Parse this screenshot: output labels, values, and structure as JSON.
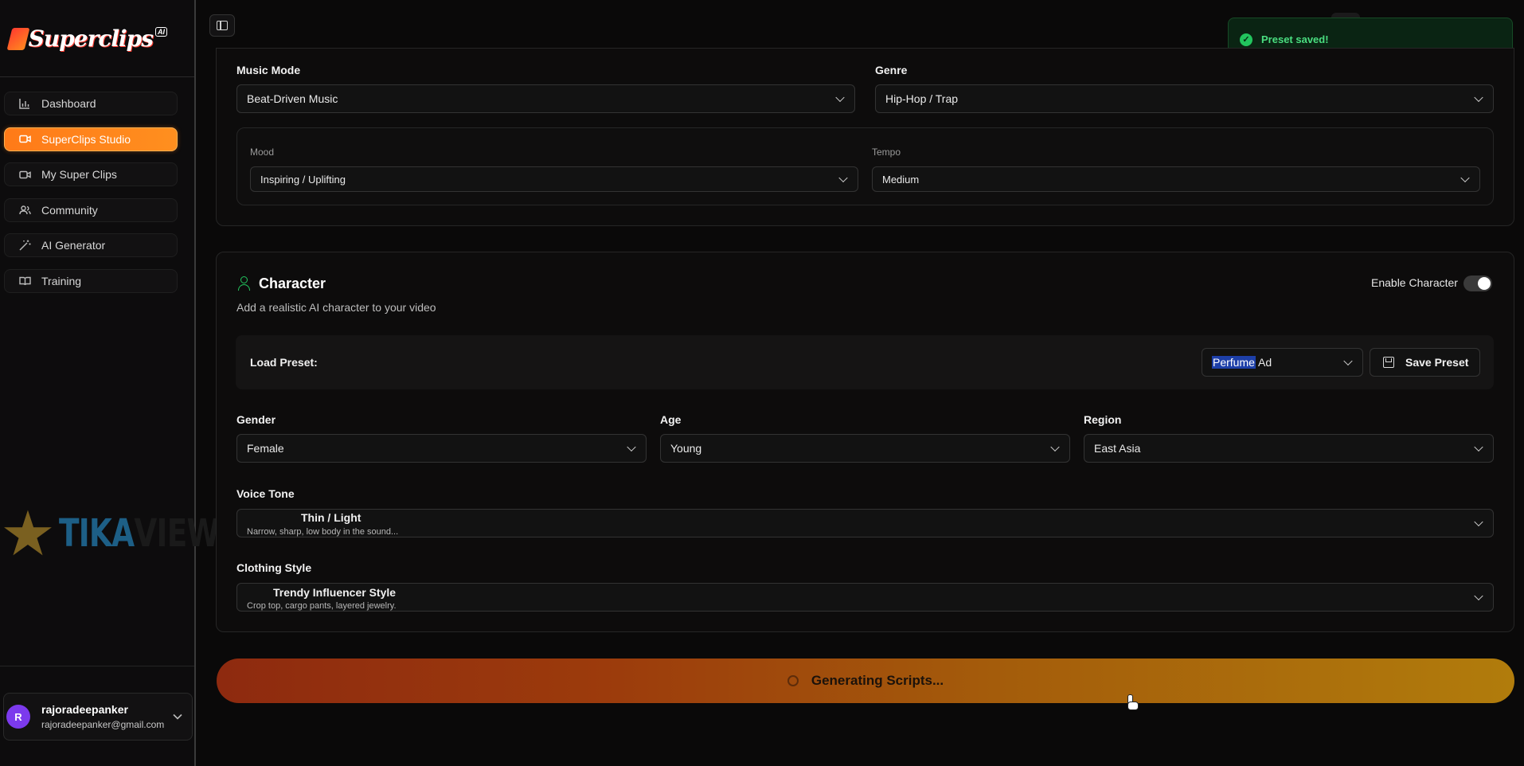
{
  "brand": {
    "name": "Superclips",
    "badge": "AI"
  },
  "watermark": {
    "text_main": "TIKA",
    "text_faded": "VIEW"
  },
  "sidebar": {
    "items": [
      {
        "label": "Dashboard",
        "icon": "bar-chart-icon",
        "active": false
      },
      {
        "label": "SuperClips Studio",
        "icon": "video-camera-icon",
        "active": true
      },
      {
        "label": "My Super Clips",
        "icon": "video-camera-icon",
        "active": false
      },
      {
        "label": "Community",
        "icon": "users-icon",
        "active": false
      },
      {
        "label": "AI Generator",
        "icon": "magic-wand-icon",
        "active": false
      },
      {
        "label": "Training",
        "icon": "book-open-icon",
        "active": false
      }
    ]
  },
  "user": {
    "initial": "R",
    "name": "rajoradeepanker",
    "email": "rajoradeepanker@gmail.com"
  },
  "toast": {
    "text": "Preset saved!",
    "color": "#22c55e"
  },
  "music": {
    "mode_label": "Music Mode",
    "mode_value": "Beat-Driven Music",
    "genre_label": "Genre",
    "genre_value": "Hip-Hop / Trap",
    "mood_label": "Mood",
    "mood_value": "Inspiring / Uplifting",
    "tempo_label": "Tempo",
    "tempo_value": "Medium"
  },
  "character": {
    "title": "Character",
    "description": "Add a realistic AI character to your video",
    "enable_label": "Enable Character",
    "enabled": true,
    "preset_label": "Load Preset:",
    "preset_value_highlight": "Perfume",
    "preset_value_rest": " Ad",
    "save_preset_label": "Save Preset",
    "gender_label": "Gender",
    "gender_value": "Female",
    "age_label": "Age",
    "age_value": "Young",
    "region_label": "Region",
    "region_value": "East Asia",
    "voice_label": "Voice Tone",
    "voice_value": "Thin / Light",
    "voice_desc": "Narrow, sharp, low body in the sound...",
    "clothing_label": "Clothing Style",
    "clothing_value": "Trendy Influencer Style",
    "clothing_desc": "Crop top, cargo pants, layered jewelry."
  },
  "generate": {
    "label": "Generating Scripts..."
  },
  "colors": {
    "accent": "#ff7a18",
    "success": "#22c55e",
    "highlight": "#1d3fa8"
  }
}
